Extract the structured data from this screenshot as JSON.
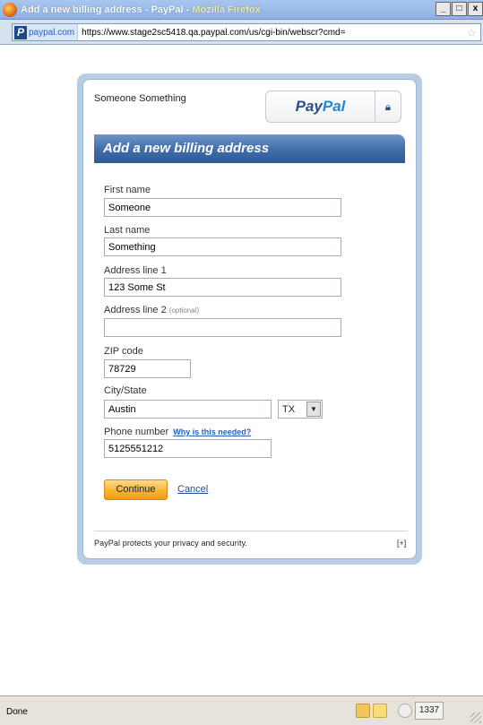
{
  "window": {
    "title_prefix": "Add a new billing address - PayPal - ",
    "title_app": "Mozilla Firefox",
    "min_label": "_",
    "max_label": "□",
    "close_label": "x"
  },
  "address_bar": {
    "site_badge": "paypal.com",
    "url": "https://www.stage2sc5418.qa.paypal.com/us/cgi-bin/webscr?cmd="
  },
  "account": {
    "name": "Someone Something"
  },
  "brand": {
    "logo_part1": "Pay",
    "logo_part2": "Pal"
  },
  "section": {
    "title": "Add a new billing address"
  },
  "form": {
    "first_name": {
      "label": "First name",
      "value": "Someone"
    },
    "last_name": {
      "label": "Last name",
      "value": "Something"
    },
    "address1": {
      "label": "Address line 1",
      "value": "123 Some St"
    },
    "address2": {
      "label": "Address line 2",
      "optional": "(optional)",
      "value": ""
    },
    "zip": {
      "label": "ZIP code",
      "value": "78729"
    },
    "city_state": {
      "label": "City/State",
      "city_value": "Austin",
      "state_value": "TX"
    },
    "phone": {
      "label": "Phone number",
      "why_link": "Why is this needed?",
      "value": "5125551212"
    },
    "continue_label": "Continue",
    "cancel_label": "Cancel"
  },
  "footer": {
    "privacy_text": "PayPal protects your privacy and security.",
    "expand_label": "[+]"
  },
  "status_bar": {
    "status": "Done",
    "count": "1337"
  },
  "colors": {
    "section_bar": "#3f6ca9",
    "continue_button": "#f7b531",
    "link": "#1d4ea0"
  }
}
